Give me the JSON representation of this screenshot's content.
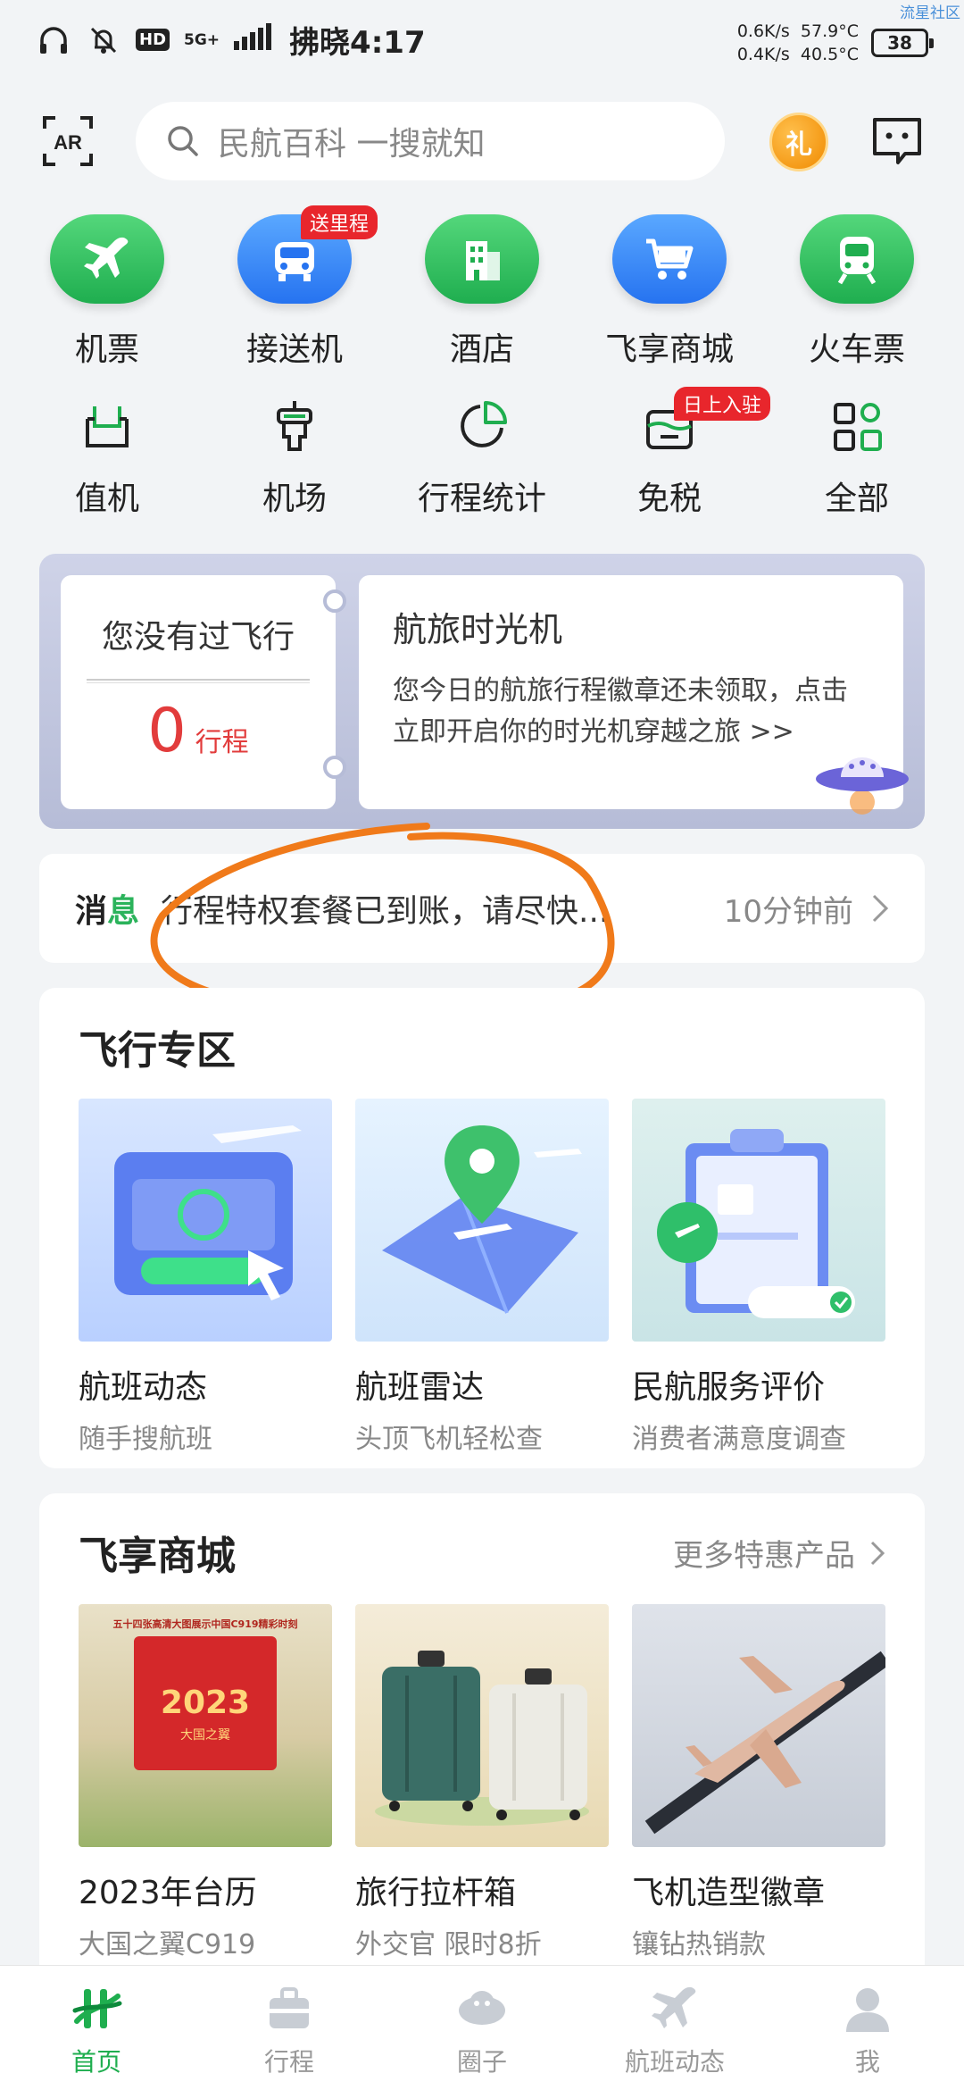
{
  "status_bar": {
    "time": "拂晓4:17",
    "net_type": "5G+",
    "hd": "HD",
    "speed_up": "0.6K/s",
    "speed_down": "0.4K/s",
    "cpu_temp": "57.9°C",
    "battery_temp": "40.5°C",
    "battery": "38",
    "watermark": "流星社区"
  },
  "header": {
    "ar_label": "AR",
    "search_placeholder": "民航百科 一搜就知",
    "gift_label": "礼"
  },
  "main_icons": [
    {
      "label": "机票",
      "icon": "plane-icon",
      "color": "#1fae4f"
    },
    {
      "label": "接送机",
      "icon": "car-icon",
      "color": "#2673f0",
      "badge": "送里程"
    },
    {
      "label": "酒店",
      "icon": "hotel-icon",
      "color": "#1fae4f"
    },
    {
      "label": "飞享商城",
      "icon": "cart-icon",
      "color": "#2673f0"
    },
    {
      "label": "火车票",
      "icon": "train-icon",
      "color": "#1fae4f"
    }
  ],
  "sub_icons": [
    {
      "label": "值机",
      "icon": "checkin-icon"
    },
    {
      "label": "机场",
      "icon": "airport-icon"
    },
    {
      "label": "行程统计",
      "icon": "pie-chart-icon"
    },
    {
      "label": "免税",
      "icon": "dutyfree-icon",
      "badge": "日上入驻"
    },
    {
      "label": "全部",
      "icon": "grid-icon"
    }
  ],
  "time_machine": {
    "left_title": "您没有过飞行",
    "count": "0",
    "count_unit": "行程",
    "right_title": "航旅时光机",
    "right_desc": "您今日的航旅行程徽章还未领取，点击立即开启你的时光机穿越之旅 >>"
  },
  "notice": {
    "tag_part1": "消",
    "tag_part2": "息",
    "text": "行程特权套餐已到账，请尽快...",
    "time": "10分钟前"
  },
  "flight_zone": {
    "title": "飞行专区",
    "items": [
      {
        "title": "航班动态",
        "subtitle": "随手搜航班"
      },
      {
        "title": "航班雷达",
        "subtitle": "头顶飞机轻松查"
      },
      {
        "title": "民航服务评价",
        "subtitle": "消费者满意度调查"
      }
    ]
  },
  "mall": {
    "title": "飞享商城",
    "more": "更多特惠产品",
    "items": [
      {
        "title": "2023年台历",
        "subtitle": "大国之翼C919",
        "img_top_text": "五十四张高清大图展示中国C919精彩时刻",
        "img_year": "2023",
        "img_sub": "大国之翼"
      },
      {
        "title": "旅行拉杆箱",
        "subtitle": "外交官 限时8折"
      },
      {
        "title": "飞机造型徽章",
        "subtitle": "镶钻热销款"
      }
    ]
  },
  "bottom_nav": [
    {
      "label": "首页",
      "active": true
    },
    {
      "label": "行程",
      "active": false
    },
    {
      "label": "圈子",
      "active": false
    },
    {
      "label": "航班动态",
      "active": false
    },
    {
      "label": "我",
      "active": false
    }
  ],
  "colors": {
    "brand_green": "#1fae4f",
    "brand_blue": "#2673f0",
    "badge_red": "#e8262c",
    "annotation_orange": "#f07a1a"
  }
}
